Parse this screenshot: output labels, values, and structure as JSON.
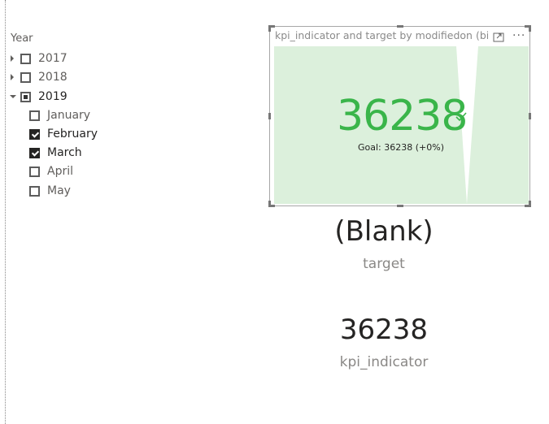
{
  "slicer": {
    "title": "Year",
    "years": [
      {
        "label": "2017",
        "expanded": false,
        "state": "unchecked"
      },
      {
        "label": "2018",
        "expanded": false,
        "state": "unchecked"
      },
      {
        "label": "2019",
        "expanded": true,
        "state": "partial"
      }
    ],
    "months": [
      {
        "label": "January",
        "checked": false
      },
      {
        "label": "February",
        "checked": true
      },
      {
        "label": "March",
        "checked": true
      },
      {
        "label": "April",
        "checked": false
      },
      {
        "label": "May",
        "checked": false
      }
    ]
  },
  "kpi_visual": {
    "header_title": "kpi_indicator and target by modifiedon (bir",
    "value": "36238",
    "goal_text": "Goal: 36238 (+0%)",
    "status": "on-target",
    "colors": {
      "value": "#3ab54a",
      "background": "#dcf0dc"
    }
  },
  "card_target": {
    "value": "(Blank)",
    "label": "target"
  },
  "card_kpi": {
    "value": "36238",
    "label": "kpi_indicator"
  }
}
